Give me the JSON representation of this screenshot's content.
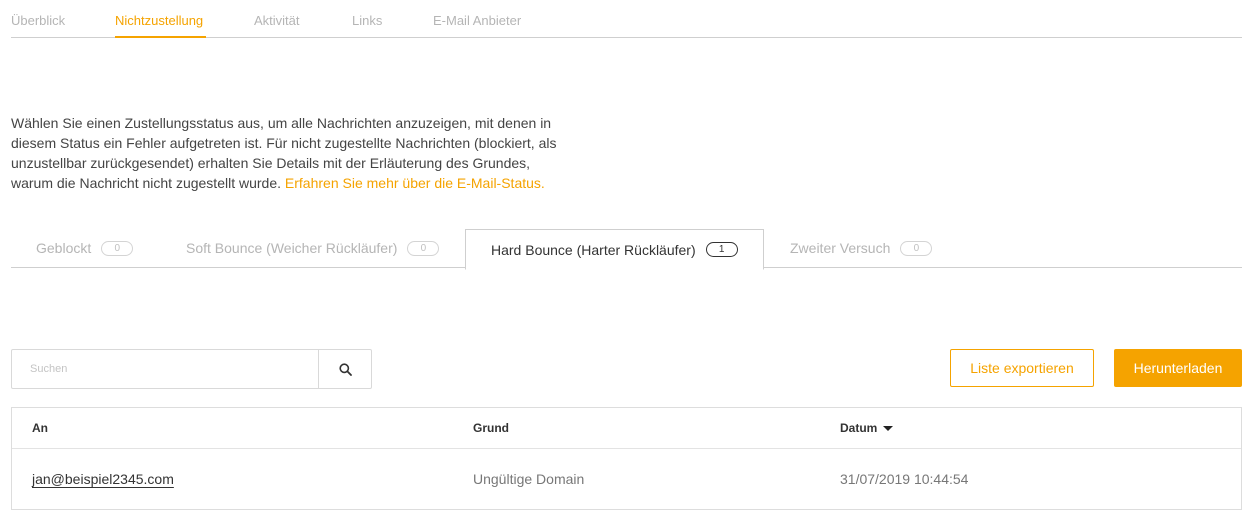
{
  "topnav": {
    "tabs": [
      "Überblick",
      "Nichtzustellung",
      "Aktivität",
      "Links",
      "E-Mail Anbieter"
    ],
    "active": "Nichtzustellung"
  },
  "description": {
    "text": "Wählen Sie einen Zustellungsstatus aus, um alle Nachrichten anzuzeigen, mit denen in diesem Status ein Fehler aufgetreten ist. Für nicht zugestellte Nachrichten (blockiert, als unzustellbar zurückgesendet) erhalten Sie Details mit der Erläuterung des Grundes, warum die Nachricht nicht zugestellt wurde.",
    "link": "Erfahren Sie mehr über die E-Mail-Status."
  },
  "status_tabs": [
    {
      "label": "Geblockt",
      "count": "0"
    },
    {
      "label": "Soft Bounce (Weicher Rückläufer)",
      "count": "0"
    },
    {
      "label": "Hard Bounce (Harter Rückläufer)",
      "count": "1"
    },
    {
      "label": "Zweiter Versuch",
      "count": "0"
    }
  ],
  "active_status_tab": "Hard Bounce (Harter Rückläufer)",
  "search": {
    "placeholder": "Suchen",
    "icon": "search-icon"
  },
  "buttons": {
    "export": "Liste exportieren",
    "download": "Herunterladen"
  },
  "table": {
    "columns": [
      "An",
      "Grund",
      "Datum"
    ],
    "sort_column": "Datum",
    "sort_direction": "descending",
    "rows": [
      {
        "to": "jan@beispiel2345.com",
        "reason": "Ungültige Domain",
        "date": "31/07/2019 10:44:54"
      }
    ]
  },
  "colors": {
    "accent": "#f5a300",
    "border": "#cfcfcf",
    "muted_text": "#b5b5b5"
  }
}
